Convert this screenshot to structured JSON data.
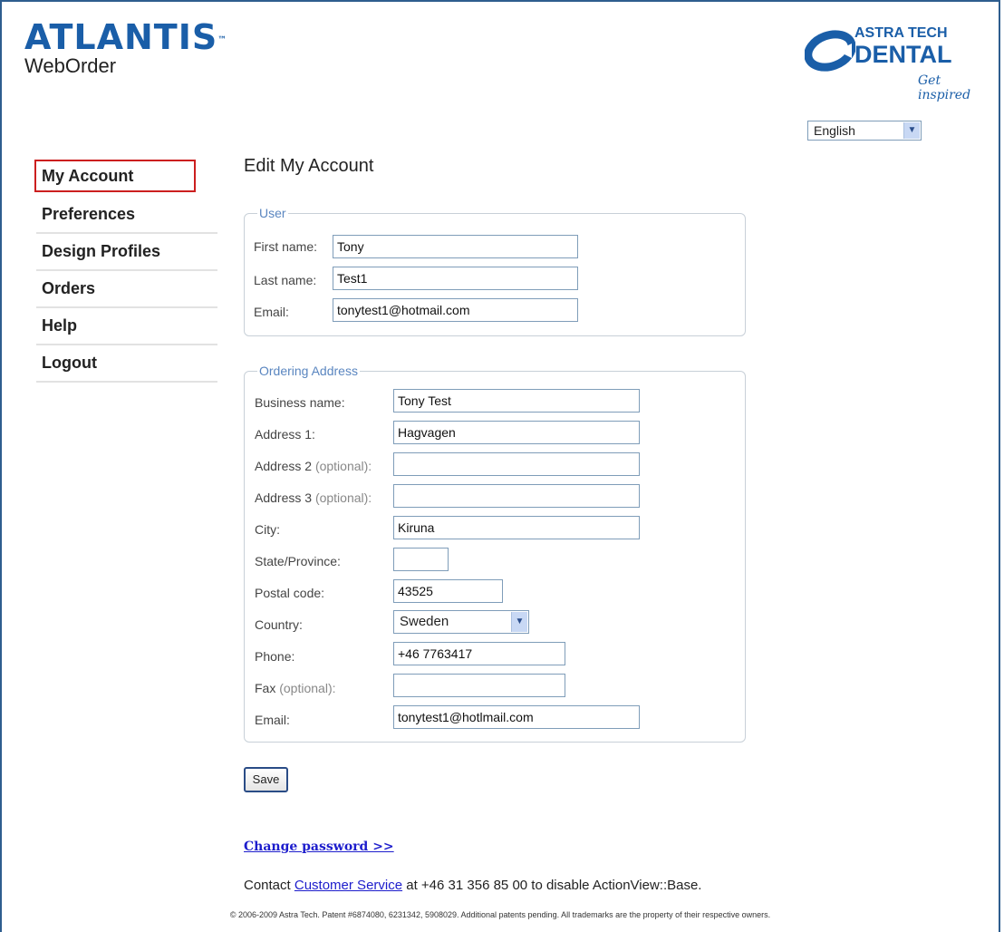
{
  "header": {
    "brand_main": "ATLANTIS",
    "brand_tm": "™",
    "brand_sub": "WebOrder",
    "partner_line1": "ASTRA TECH",
    "partner_line2": "DENTAL",
    "partner_tagline": "Get inspired"
  },
  "language": {
    "selected": "English"
  },
  "sidebar": {
    "items": [
      {
        "label": "My Account"
      },
      {
        "label": "Preferences"
      },
      {
        "label": "Design Profiles"
      },
      {
        "label": "Orders"
      },
      {
        "label": "Help"
      },
      {
        "label": "Logout"
      }
    ]
  },
  "page_title": "Edit My Account",
  "user": {
    "legend": "User",
    "first_name_label": "First name:",
    "first_name": "Tony",
    "last_name_label": "Last name:",
    "last_name": "Test1",
    "email_label": "Email:",
    "email": "tonytest1@hotmail.com"
  },
  "address": {
    "legend": "Ordering Address",
    "business_label": "Business name:",
    "business": "Tony Test",
    "address1_label": "Address 1:",
    "address1": "Hagvagen",
    "address2_label": "Address 2",
    "address2": "",
    "address3_label": "Address 3",
    "address3": "",
    "optional_suffix": "(optional):",
    "city_label": "City:",
    "city": "Kiruna",
    "state_label": "State/Province:",
    "state": "",
    "postal_label": "Postal code:",
    "postal": "43525",
    "country_label": "Country:",
    "country": "Sweden",
    "phone_label": "Phone:",
    "phone": "+46 7763417",
    "fax_label": "Fax",
    "fax": "",
    "email_label": "Email:",
    "email": "tonytest1@hotlmail.com"
  },
  "save_label": "Save",
  "change_password": "Change password >>",
  "contact": {
    "prefix": "Contact",
    "link": "Customer Service",
    "suffix": "at +46 31 356 85 00 to disable ActionView::Base."
  },
  "footer": "© 2006-2009 Astra Tech.   Patent #6874080, 6231342, 5908029.  Additional patents pending.  All trademarks are the property of their respective owners."
}
